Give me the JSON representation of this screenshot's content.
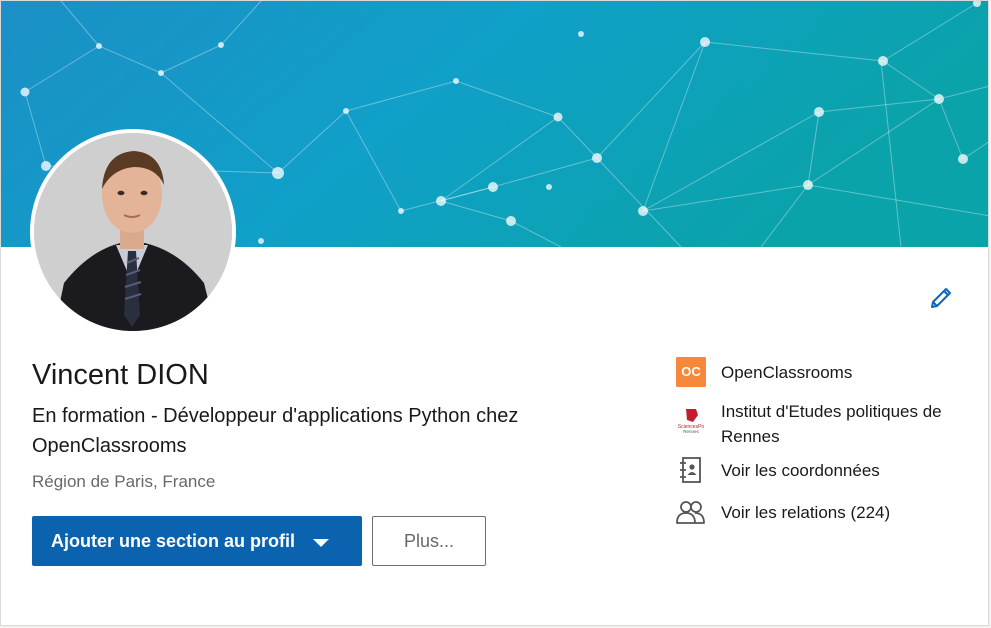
{
  "profile": {
    "name": "Vincent DION",
    "headline": "En formation - Développeur d'applications Python chez OpenClassrooms",
    "location": "Région de Paris, France"
  },
  "actions": {
    "add_section_label": "Ajouter une section au profil",
    "more_label": "Plus..."
  },
  "sidebar": {
    "items": [
      {
        "label": "OpenClassrooms",
        "icon": "openclassrooms-logo"
      },
      {
        "label": "Institut d'Etudes politiques de Rennes",
        "icon": "sciencespo-rennes-logo"
      },
      {
        "label": "Voir les coordonnées",
        "icon": "contact-card-icon"
      },
      {
        "label": "Voir les relations (224)",
        "icon": "connections-icon"
      }
    ]
  },
  "logos": {
    "openclassrooms_mark": "OC",
    "sciencespo_mark": "SciencesPo",
    "sciencespo_sub": "Rennes"
  },
  "colors": {
    "primary": "#0b63b0",
    "banner_start": "#1f9fd0",
    "banner_end": "#08a4a8",
    "openclassrooms": "#f7873a",
    "sciencespo": "#c0202e",
    "edit_icon": "#0a66c2"
  }
}
